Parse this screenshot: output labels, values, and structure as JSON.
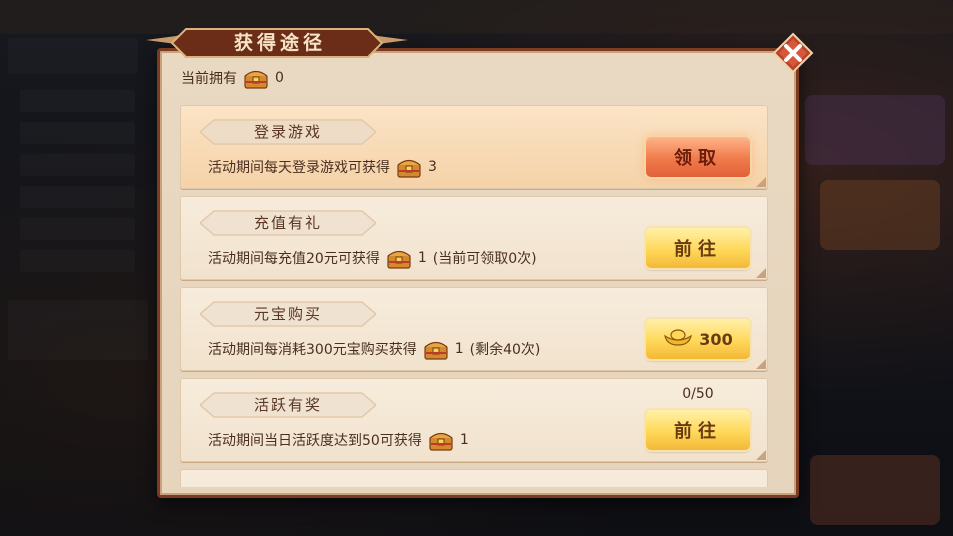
{
  "dialog": {
    "title": "获得途径",
    "owned_label": "当前拥有",
    "owned_value": "0"
  },
  "tasks": [
    {
      "title": "登录游戏",
      "desc_prefix": "活动期间每天登录游戏可获得",
      "reward": "3",
      "extra": "",
      "button": "领取",
      "button_type": "claim",
      "progress": ""
    },
    {
      "title": "充值有礼",
      "desc_prefix": "活动期间每充值20元可获得",
      "reward": "1",
      "extra": "(当前可领取0次)",
      "button": "前往",
      "button_type": "go",
      "progress": ""
    },
    {
      "title": "元宝购买",
      "desc_prefix": "活动期间每消耗300元宝购买获得",
      "reward": "1",
      "extra": "(剩余40次)",
      "button": "300",
      "button_type": "buy",
      "progress": ""
    },
    {
      "title": "活跃有奖",
      "desc_prefix": "活动期间当日活跃度达到50可获得",
      "reward": "1",
      "extra": "",
      "button": "前往",
      "button_type": "go",
      "progress": "0/50"
    }
  ],
  "icons": {
    "close": "close-icon",
    "chest": "treasure-chest-icon",
    "ingot": "gold-ingot-icon"
  },
  "colors": {
    "frame": "#7a3b22",
    "panel": "#e9d9c2",
    "claim_button": "#f07a4a",
    "go_button": "#ffd85a",
    "text": "#4a2f20"
  }
}
